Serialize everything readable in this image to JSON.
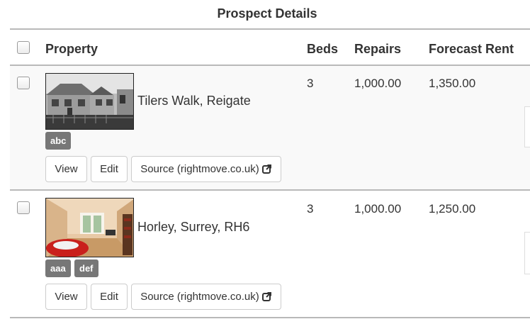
{
  "page": {
    "title": "Prospect Details"
  },
  "table": {
    "headers": {
      "property": "Property",
      "beds": "Beds",
      "repairs": "Repairs",
      "forecast_rent": "Forecast Rent"
    },
    "rows": [
      {
        "address": "Tilers Walk, Reigate",
        "tags": [
          "abc"
        ],
        "beds": "3",
        "repairs": "1,000.00",
        "forecast_rent": "1,350.00",
        "thumbnail": "terraced-houses-photo",
        "actions": {
          "view": "View",
          "edit": "Edit",
          "source": "Source (rightmove.co.uk)"
        }
      },
      {
        "address": "Horley, Surrey, RH6",
        "tags": [
          "aaa",
          "def"
        ],
        "beds": "3",
        "repairs": "1,000.00",
        "forecast_rent": "1,250.00",
        "thumbnail": "living-room-photo",
        "actions": {
          "view": "View",
          "edit": "Edit",
          "source": "Source (rightmove.co.uk)"
        }
      }
    ]
  },
  "colors": {
    "tag_bg": "#777777",
    "row_stripe": "#f9f9f9",
    "border": "#b9b9b9"
  }
}
